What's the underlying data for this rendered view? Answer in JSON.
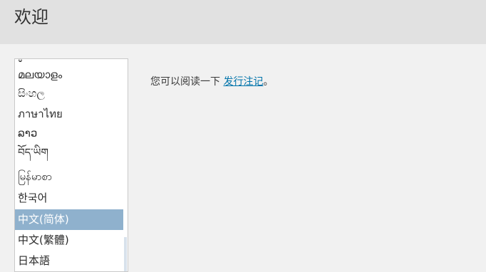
{
  "header": {
    "title": "欢迎"
  },
  "language_list": {
    "items": [
      {
        "label": "ಕ",
        "selected": false
      },
      {
        "label": "മലയാളം",
        "selected": false
      },
      {
        "label": "සිංහල",
        "selected": false
      },
      {
        "label": "ภาษาไทย",
        "selected": false
      },
      {
        "label": "ລາວ",
        "selected": false
      },
      {
        "label": "བོད་ཡིག",
        "selected": false
      },
      {
        "label": "မြန်မာစာ",
        "selected": false
      },
      {
        "label": "한국어",
        "selected": false
      },
      {
        "label": "中文(简体)",
        "selected": true
      },
      {
        "label": "中文(繁體)",
        "selected": false
      },
      {
        "label": "日本語",
        "selected": false
      }
    ]
  },
  "main": {
    "text_before": "您可以阅读一下 ",
    "link_label": "发行注记",
    "text_after": "。"
  },
  "colors": {
    "header_bg": "#e1e1e1",
    "selected_bg": "#8fb1cd",
    "link": "#0073aa"
  }
}
